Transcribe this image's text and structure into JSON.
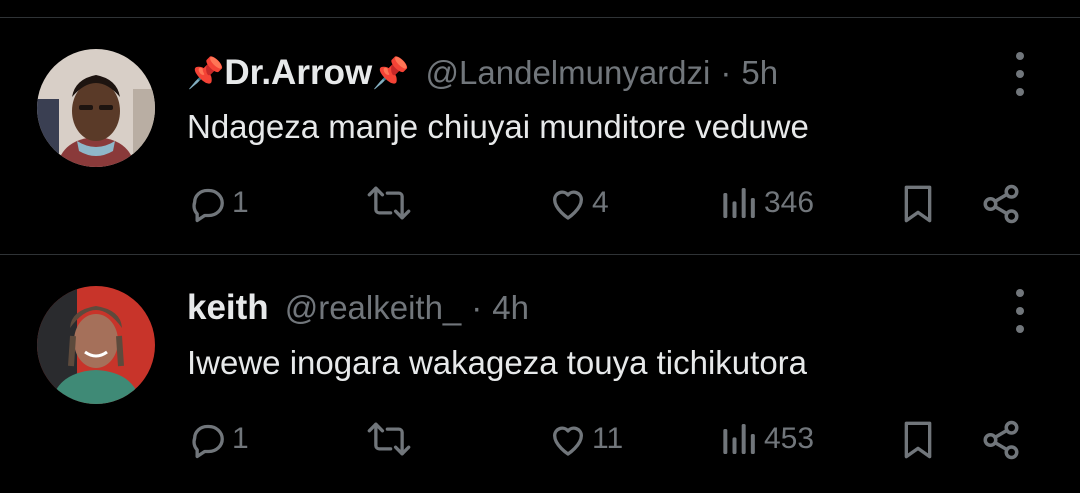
{
  "tweets": [
    {
      "name_prefix": "📌",
      "display_name": "Dr.Arrow",
      "name_suffix": "📌",
      "handle": "@Landelmunyardzi",
      "separator": "·",
      "time": "5h",
      "text": "Ndageza manje chiuyai munditore veduwe",
      "replies": "1",
      "retweets": "",
      "likes": "4",
      "views": "346"
    },
    {
      "display_name": "keith",
      "handle": "@realkeith_",
      "separator": "·",
      "time": "4h",
      "text": "Iwewe inogara wakageza touya tichikutora",
      "replies": "1",
      "retweets": "",
      "likes": "11",
      "views": "453"
    }
  ],
  "icons": {
    "reply": "reply-icon",
    "retweet": "retweet-icon",
    "like": "heart-icon",
    "views": "views-icon",
    "bookmark": "bookmark-icon",
    "share": "share-icon",
    "more": "more-icon"
  },
  "colors": {
    "background": "#000000",
    "text": "#e7e9ea",
    "secondary": "#71767b",
    "divider": "#2f3336"
  }
}
